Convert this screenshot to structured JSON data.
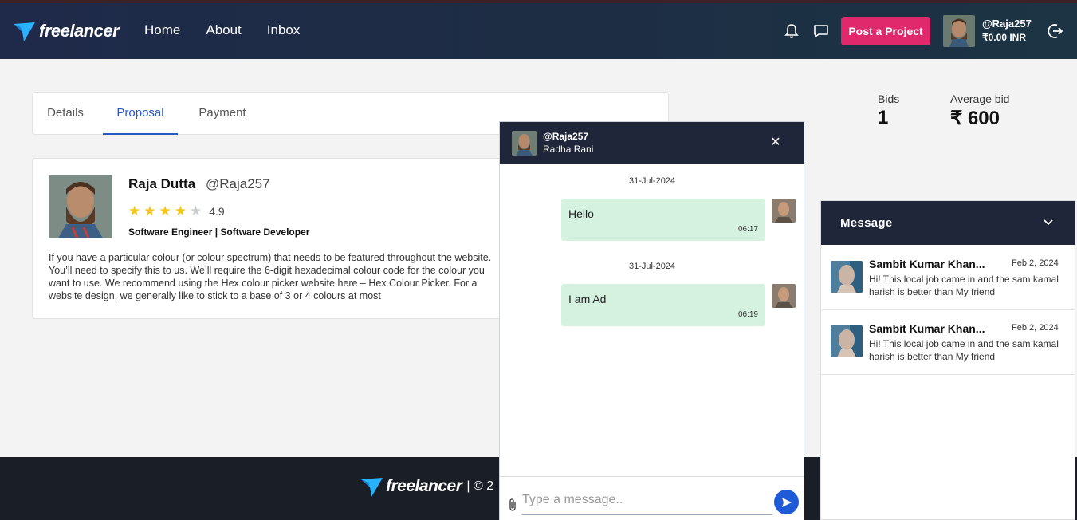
{
  "header": {
    "logo_text": "freelancer",
    "nav": [
      "Home",
      "About",
      "Inbox"
    ],
    "post_button": "Post a Project",
    "username": "@Raja257",
    "balance": "₹0.00 INR"
  },
  "tabs": [
    "Details",
    "Proposal",
    "Payment"
  ],
  "active_tab": "Proposal",
  "proposal": {
    "name": "Raja Dutta",
    "handle": "@Raja257",
    "rating": "4.9",
    "stars_filled": 4,
    "stars_total": 5,
    "role": "Software Engineer | Software Developer",
    "description": "If you have a particular colour (or colour spectrum) that needs to be featured throughout the website. You’ll need to specify this to us. We’ll require the 6-digit hexadecimal colour code for the colour you want to use. We recommend using the Hex colour picker website here – Hex Colour Picker. For a website design, we generally like to stick to a base of 3 or 4 colours at most"
  },
  "stats": {
    "bids_label": "Bids",
    "bids_value": "1",
    "avg_label": "Average bid",
    "avg_value": "₹ 600"
  },
  "chat": {
    "handle": "@Raja257",
    "name": "Radha Rani",
    "messages": [
      {
        "date": "31-Jul-2024",
        "text": "Hello",
        "time": "06:17"
      },
      {
        "date": "31-Jul-2024",
        "text": "I am Ad",
        "time": "06:19"
      }
    ],
    "input_placeholder": "Type a message.."
  },
  "message_panel": {
    "title": "Message",
    "items": [
      {
        "name": "Sambit Kumar Khan...",
        "date": "Feb 2, 2024",
        "preview": "Hi! This local job came in and the sam kamal harish is better than My friend"
      },
      {
        "name": "Sambit Kumar Khan...",
        "date": "Feb 2, 2024",
        "preview": "Hi! This local job came in and the sam kamal harish is better than My friend"
      }
    ]
  },
  "footer": {
    "logo_text": "freelancer",
    "copyright": "| © 2"
  },
  "colors": {
    "accent": "#e0286d",
    "tab_active": "#2a56c6",
    "chat_header": "#1f2639",
    "bubble": "#d4f2df",
    "star": "#f5c518"
  }
}
